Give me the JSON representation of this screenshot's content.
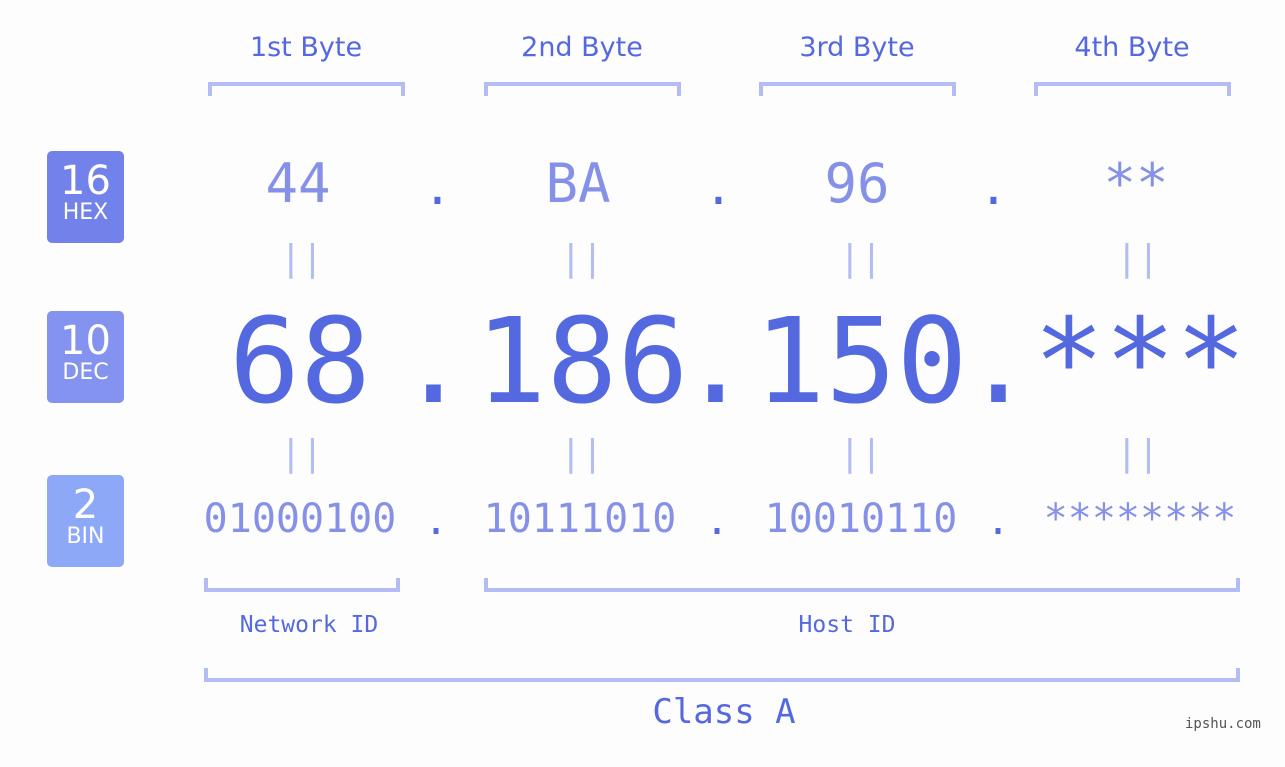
{
  "bytes": {
    "labels": [
      "1st Byte",
      "2nd Byte",
      "3rd Byte",
      "4th Byte"
    ]
  },
  "badges": {
    "hex": {
      "number": "16",
      "base": "HEX",
      "color": "#7382ea"
    },
    "dec": {
      "number": "10",
      "base": "DEC",
      "color": "#8492f0"
    },
    "bin": {
      "number": "2",
      "base": "BIN",
      "color": "#8ea8f8"
    }
  },
  "hex": [
    "44",
    "BA",
    "96",
    "**"
  ],
  "dec": [
    "68",
    "186",
    "150",
    "***"
  ],
  "bin": [
    "01000100",
    "10111010",
    "10010110",
    "********"
  ],
  "separator": ".",
  "equals": "||",
  "network_id_label": "Network ID",
  "host_id_label": "Host ID",
  "class_label": "Class A",
  "watermark": "ipshu.com",
  "colors": {
    "primary": "#5468e0",
    "light": "#8591e9",
    "bracket": "#b3bcf5"
  }
}
